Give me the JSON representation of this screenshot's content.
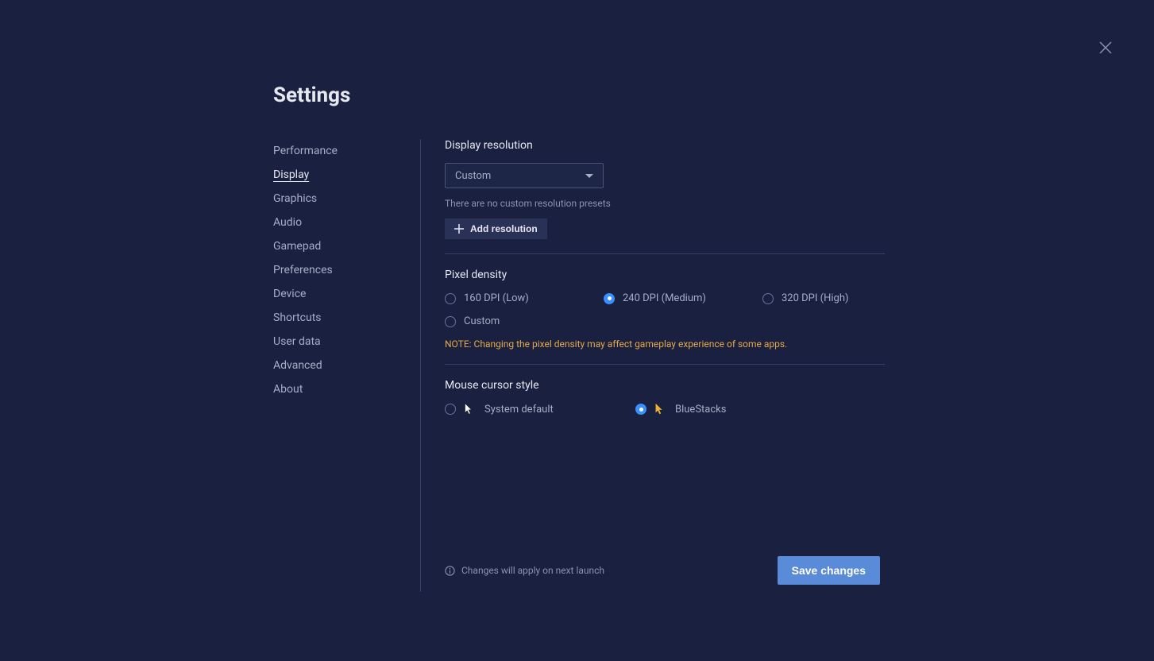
{
  "page_title": "Settings",
  "sidebar": {
    "items": [
      {
        "label": "Performance",
        "active": false
      },
      {
        "label": "Display",
        "active": true
      },
      {
        "label": "Graphics",
        "active": false
      },
      {
        "label": "Audio",
        "active": false
      },
      {
        "label": "Gamepad",
        "active": false
      },
      {
        "label": "Preferences",
        "active": false
      },
      {
        "label": "Device",
        "active": false
      },
      {
        "label": "Shortcuts",
        "active": false
      },
      {
        "label": "User data",
        "active": false
      },
      {
        "label": "Advanced",
        "active": false
      },
      {
        "label": "About",
        "active": false
      }
    ]
  },
  "display_resolution": {
    "title": "Display resolution",
    "selected": "Custom",
    "helper": "There are no custom resolution presets",
    "add_button": "Add resolution"
  },
  "pixel_density": {
    "title": "Pixel density",
    "options": [
      {
        "label": "160 DPI (Low)",
        "selected": false
      },
      {
        "label": "240 DPI (Medium)",
        "selected": true
      },
      {
        "label": "320 DPI (High)",
        "selected": false
      },
      {
        "label": "Custom",
        "selected": false
      }
    ],
    "note": "NOTE: Changing the pixel density may affect gameplay experience of some apps."
  },
  "mouse_cursor": {
    "title": "Mouse cursor style",
    "options": [
      {
        "label": "System default",
        "selected": false
      },
      {
        "label": "BlueStacks",
        "selected": true
      }
    ]
  },
  "footer": {
    "info": "Changes will apply on next launch",
    "save": "Save changes"
  }
}
